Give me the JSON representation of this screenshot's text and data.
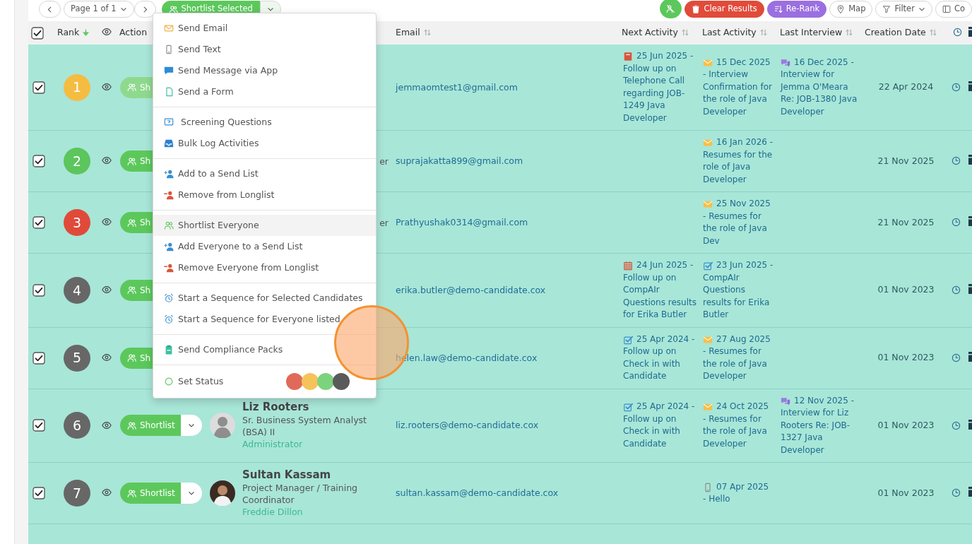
{
  "toolbar": {
    "previous": {
      "kind": "prev"
    },
    "page_select": {
      "label": "Page 1 of 1"
    },
    "next": {
      "kind": "next"
    },
    "bulk_button": {
      "label": "Shortlist Selected",
      "expanded": true
    },
    "right_buttons": [
      {
        "kind": "unshortlist"
      },
      {
        "kind": "clear",
        "label": "Clear Results"
      },
      {
        "kind": "rerank",
        "label": "Re-Rank"
      },
      {
        "kind": "map",
        "label": "Map"
      },
      {
        "kind": "filter",
        "label": "Filter"
      },
      {
        "kind": "columns",
        "label": "Co"
      }
    ]
  },
  "table": {
    "columns": [
      {
        "kind": "checkbox",
        "checked": true
      },
      {
        "kind": "sortable",
        "label": "Rank",
        "sorted": true
      },
      {
        "kind": "eye"
      },
      {
        "kind": "plain",
        "label": "Action"
      },
      {
        "kind": "blank"
      },
      {
        "kind": "blank"
      },
      {
        "kind": "sortable",
        "label": "Email",
        "sorted": false
      },
      {
        "kind": "sortable",
        "label": "Next Activity",
        "sorted": false
      },
      {
        "kind": "sortable",
        "label": "Last Activity",
        "sorted": false
      },
      {
        "kind": "sortable",
        "label": "Last Interview",
        "sorted": false
      },
      {
        "kind": "sortable",
        "label": "Creation Date",
        "sorted": false
      },
      {
        "kind": "clock"
      },
      {
        "kind": "info"
      }
    ],
    "rows": [
      {
        "checked": true,
        "rank": "1",
        "color": "#f5bc42",
        "action": {
          "label": "Sh",
          "disabled": true,
          "clipped": true
        },
        "email": "jemmaomtest1@gmail.com",
        "next": {
          "kind": "call",
          "text": "25 Jun 2025 - Follow up on Telephone Call regarding JOB-1249 Java Developer"
        },
        "last": {
          "kind": "email",
          "text": "15 Dec 2025 - Interview Confirmation for the role of Java Developer"
        },
        "interview": {
          "kind": "interview",
          "text": "16 Dec 2025 - Interview for Jemma O'Meara Re: JOB-1380 Java Developer"
        },
        "created": "22 Apr 2024"
      },
      {
        "checked": true,
        "rank": "2",
        "color": "#5cc55c",
        "action": {
          "label": "Sh",
          "disabled": false,
          "clipped": true
        },
        "title": "er",
        "email": "suprajakatta899@gmail.com",
        "last": {
          "kind": "email",
          "text": "16 Jan 2026 - Resumes for the role of Java Developer"
        },
        "created": "21 Nov 2025"
      },
      {
        "checked": true,
        "rank": "3",
        "color": "#e04a3a",
        "action": {
          "label": "Sh",
          "disabled": false,
          "clipped": true
        },
        "title": "er",
        "email": "Prathyushak0314@gmail.com",
        "last": {
          "kind": "email",
          "text": "25 Nov 2025 - Resumes for the role of Java Dev"
        },
        "created": "21 Nov 2025"
      },
      {
        "checked": true,
        "rank": "4",
        "color": "#676767",
        "action": {
          "label": "Sh",
          "disabled": false,
          "clipped": true
        },
        "email": "erika.butler@demo-candidate.cox",
        "next": {
          "kind": "meeting",
          "text": "24 Jun 2025 - Follow up on CompAIr Questions results for Erika Butler"
        },
        "last": {
          "kind": "task",
          "text": "23 Jun 2025 - CompAIr Questions results for Erika Butler"
        },
        "created": "01 Nov 2023"
      },
      {
        "checked": true,
        "rank": "5",
        "color": "#676767",
        "action": {
          "label": "Sh",
          "disabled": false,
          "clipped": true
        },
        "email": "helen.law@demo-candidate.cox",
        "next": {
          "kind": "task",
          "text": "25 Apr 2024 - Follow up on Check in with Candidate"
        },
        "last": {
          "kind": "email",
          "text": "27 Aug 2025 - Resumes for the role of Java Developer"
        },
        "created": "01 Nov 2023"
      },
      {
        "checked": true,
        "rank": "6",
        "color": "#676767",
        "action": {
          "label": "Shortlist",
          "disabled": false,
          "clipped": false
        },
        "avatar": {
          "photo": false
        },
        "name": "Liz Rooters",
        "title": "Sr. Business System Analyst (BSA) II",
        "owner": "Administrator",
        "email": "liz.rooters@demo-candidate.cox",
        "next": {
          "kind": "task",
          "text": "25 Apr 2024 - Follow up on Check in with Candidate"
        },
        "last": {
          "kind": "email",
          "text": "24 Oct 2025 - Resumes for the role of Java Developer"
        },
        "interview": {
          "kind": "interview",
          "text": "12 Nov 2025 - Interview for Liz Rooters Re: JOB-1327 Java Developer"
        },
        "created": "01 Nov 2023"
      },
      {
        "checked": true,
        "rank": "7",
        "color": "#676767",
        "action": {
          "label": "Shortlist",
          "disabled": false,
          "clipped": false
        },
        "avatar": {
          "photo": true
        },
        "name": "Sultan Kassam",
        "title": "Project Manager / Training Coordinator",
        "owner": "Freddie Dillon",
        "email": "sultan.kassam@demo-candidate.cox",
        "last": {
          "kind": "text",
          "text": "07 Apr 2025 - Hello"
        },
        "created": "01 Nov 2023"
      }
    ]
  },
  "bulk_menu": {
    "open": true,
    "groups": [
      [
        {
          "kind": "email",
          "label": "Send Email",
          "highlighted": false
        },
        {
          "kind": "text",
          "label": "Send Text",
          "highlighted": false
        },
        {
          "kind": "message",
          "label": "Send Message via App",
          "highlighted": false
        },
        {
          "kind": "form",
          "label": "Send a Form",
          "highlighted": false
        }
      ],
      [
        {
          "kind": "screening",
          "label": "Screening Questions",
          "highlighted": false
        },
        {
          "kind": "log",
          "label": "Bulk Log Activities",
          "highlighted": false
        }
      ],
      [
        {
          "kind": "add",
          "label": "Add to a Send List",
          "highlighted": false
        },
        {
          "kind": "remove",
          "label": "Remove from Longlist",
          "highlighted": false
        }
      ],
      [
        {
          "kind": "shortlist",
          "label": "Shortlist Everyone",
          "highlighted": true
        },
        {
          "kind": "add",
          "label": "Add Everyone to a Send List",
          "highlighted": false
        },
        {
          "kind": "remove",
          "label": "Remove Everyone from Longlist",
          "highlighted": false
        }
      ],
      [
        {
          "kind": "sequence",
          "label": "Start a Sequence for Selected Candidates",
          "highlighted": false
        },
        {
          "kind": "sequence",
          "label": "Start a Sequence for Everyone listed",
          "highlighted": false
        }
      ],
      [
        {
          "kind": "compliance",
          "label": "Send Compliance Packs",
          "highlighted": false
        }
      ],
      [
        {
          "kind": "status",
          "label": "Set Status",
          "highlighted": false,
          "colors": [
            {
              "color": "#e06a5a"
            },
            {
              "color": "#f5c35a"
            },
            {
              "color": "#7dd37d"
            },
            {
              "color": "#5a5a5a"
            }
          ]
        }
      ]
    ]
  },
  "click_marker": {
    "shown": true
  }
}
